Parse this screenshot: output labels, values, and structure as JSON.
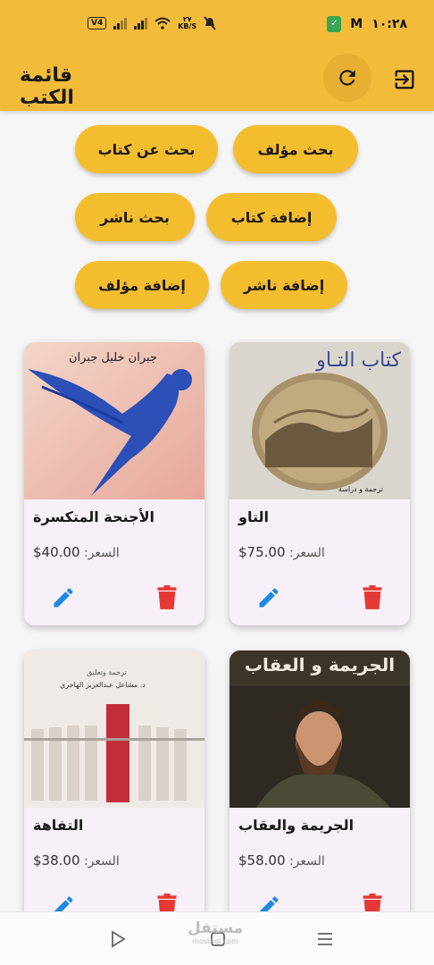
{
  "status_bar": {
    "network_badge": "V4",
    "data_speed_top": "٢٧",
    "data_speed_bottom": "KB/S",
    "time": "١٠:٢٨",
    "gmail_label": "M",
    "shield_label": "✓"
  },
  "app_bar": {
    "title": "قائمة الكتب",
    "refresh_icon": "refresh-icon",
    "logout_icon": "logout-icon"
  },
  "actions": {
    "search_author": "بحث مؤلف",
    "search_book": "بحث عن كتاب",
    "add_book": "إضافة كتاب",
    "search_publisher": "بحث ناشر",
    "add_publisher": "إضافة ناشر",
    "add_author": "إضافة مؤلف"
  },
  "books": [
    {
      "title": "التاو",
      "price_label": "السعر:",
      "price": "75.00$",
      "cover_text": "كتاب التـاو",
      "cover_sub": "ترجمة و دراسة"
    },
    {
      "title": "الأجنحة المتكسرة",
      "price_label": "السعر:",
      "price": "40.00$",
      "cover_text": "جبران خليل جبران"
    },
    {
      "title": "الجريمة والعقاب",
      "price_label": "السعر:",
      "price": "58.00$",
      "cover_text": "الجريمة و العقاب"
    },
    {
      "title": "التفاهة",
      "price_label": "السعر:",
      "price": "38.00$",
      "cover_text": "ترجمة وتعليق",
      "cover_sub": "د. مشاعل عبدالعزيز الهاجري"
    }
  ],
  "nav_bar": {
    "watermark": "مستقل",
    "watermark_sub": "mostaql.com"
  },
  "colors": {
    "accent": "#f2bb3a",
    "pill": "#f4bd2e",
    "edit": "#1e88e5",
    "delete": "#e53935",
    "card": "#f7f0f8"
  }
}
